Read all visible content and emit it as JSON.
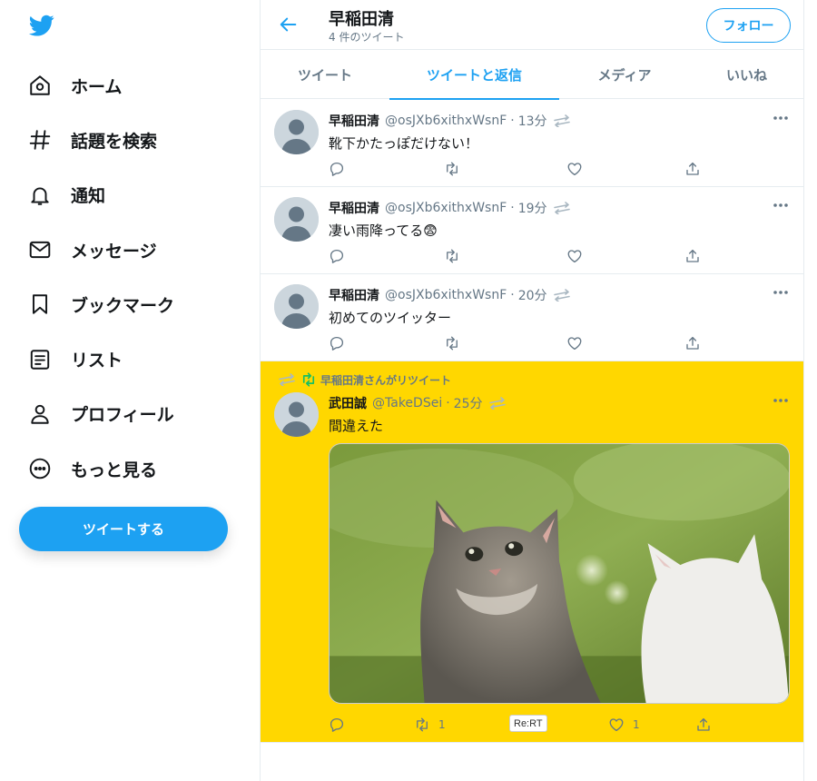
{
  "sidebar": {
    "logo_icon": "twitter-bird-icon",
    "brand_color": "#1da1f2",
    "nav": [
      {
        "icon": "home-icon",
        "label": "ホーム"
      },
      {
        "icon": "hashtag-icon",
        "label": "話題を検索"
      },
      {
        "icon": "bell-icon",
        "label": "通知"
      },
      {
        "icon": "envelope-icon",
        "label": "メッセージ"
      },
      {
        "icon": "bookmark-icon",
        "label": "ブックマーク"
      },
      {
        "icon": "list-icon",
        "label": "リスト"
      },
      {
        "icon": "profile-icon",
        "label": "プロフィール"
      },
      {
        "icon": "more-circle-icon",
        "label": "もっと見る"
      }
    ],
    "tweet_button": "ツイートする"
  },
  "header": {
    "title": "早稲田清",
    "subtitle": "4 件のツイート",
    "follow_button": "フォロー"
  },
  "tabs": [
    {
      "label": "ツイート",
      "active": false
    },
    {
      "label": "ツイートと返信",
      "active": true
    },
    {
      "label": "メディア",
      "active": false
    },
    {
      "label": "いいね",
      "active": false
    }
  ],
  "tweets": [
    {
      "name": "早稲田清",
      "handle": "@osJXb6xithxWsnF",
      "time": "13分",
      "text": "靴下かたっぽだけない！"
    },
    {
      "name": "早稲田清",
      "handle": "@osJXb6xithxWsnF",
      "time": "19分",
      "text": "凄い雨降ってる😨"
    },
    {
      "name": "早稲田清",
      "handle": "@osJXb6xithxWsnF",
      "time": "20分",
      "text": "初めてのツイッター"
    },
    {
      "retweet_label": "早稲田清さんがリツイート",
      "name": "武田誠",
      "handle": "@TakeDSei",
      "time": "25分",
      "text": "間違えた",
      "retweet_count": "1",
      "like_count": "1",
      "rert_label": "Re:RT",
      "highlight_color": "#ffd700"
    }
  ]
}
